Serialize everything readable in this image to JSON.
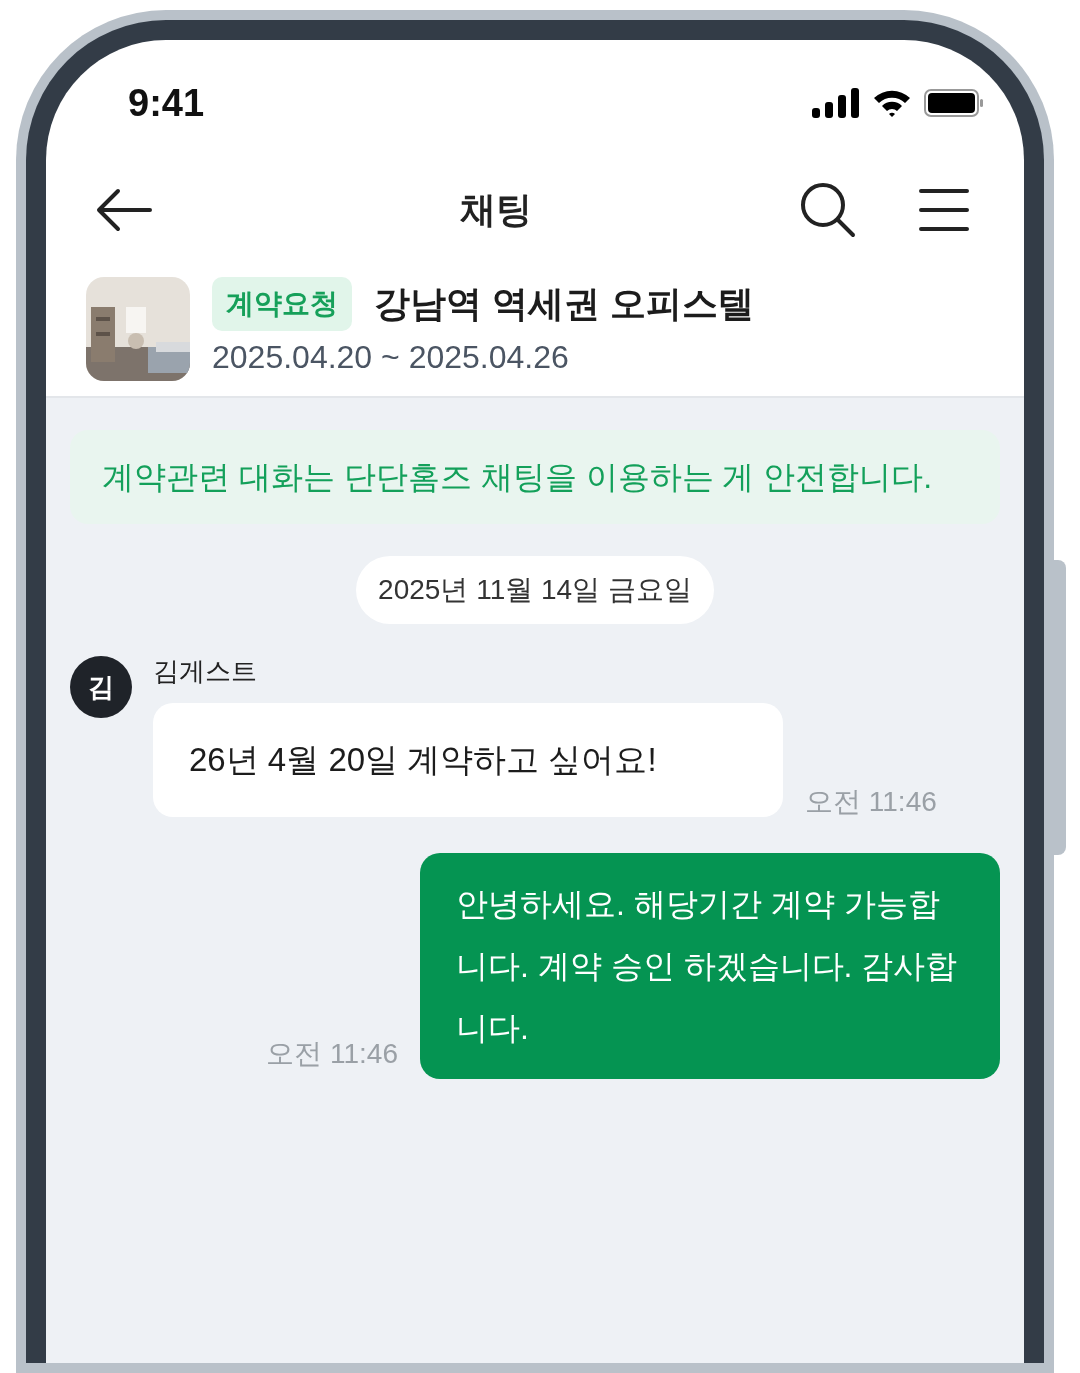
{
  "status_bar": {
    "time": "9:41"
  },
  "header": {
    "title": "채팅"
  },
  "property": {
    "badge": "계약요청",
    "title": "강남역 역세권 오피스텔",
    "dates": "2025.04.20 ~ 2025.04.26"
  },
  "notice": "계약관련 대화는 단단홈즈 채팅을 이용하는 게 안전합니다.",
  "date_divider": "2025년 11월 14일 금요일",
  "messages": [
    {
      "kind": "incoming",
      "avatar": "김",
      "sender": "김게스트",
      "text": "26년 4월 20일 계약하고 싶어요!",
      "time": "오전 11:46"
    },
    {
      "kind": "outgoing",
      "text": "안녕하세요. 해당기간 계약 가능합니다. 계약 승인 하겠습니다. 감사합니다.",
      "time": "오전 11:46"
    }
  ]
}
